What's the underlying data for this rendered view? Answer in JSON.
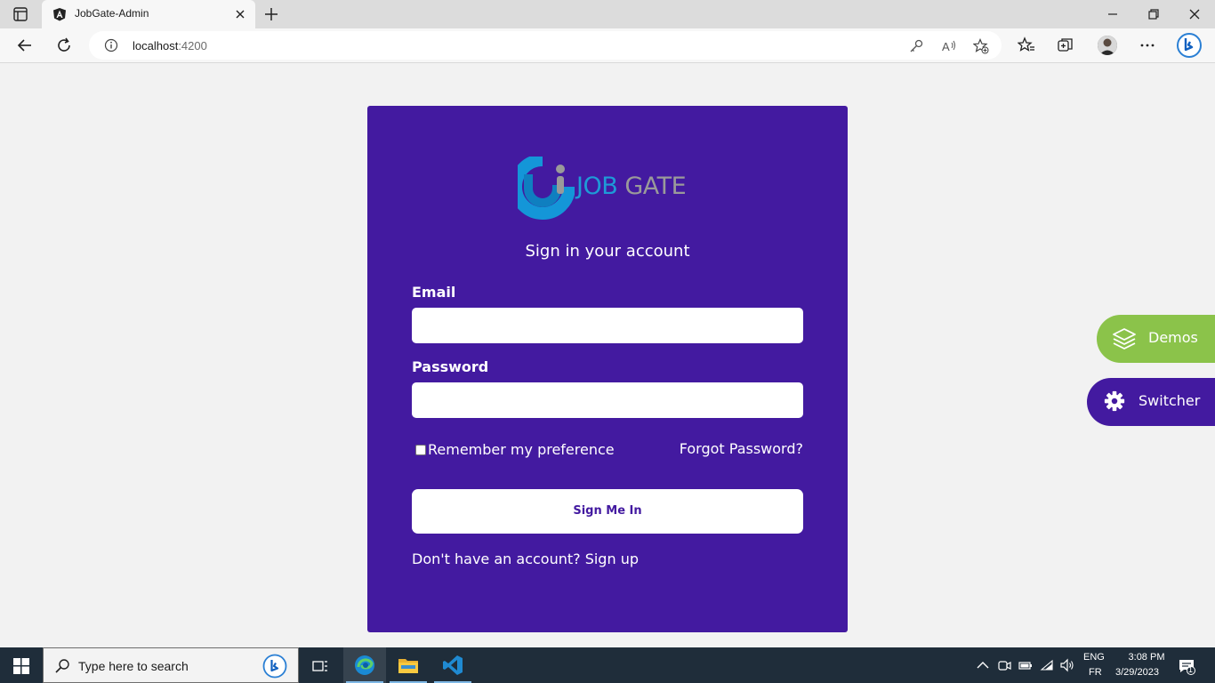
{
  "browser": {
    "tab_title": "JobGate-Admin",
    "url_host": "localhost",
    "url_port": ":4200"
  },
  "logo": {
    "word1": "JOB",
    "word2": "GATE"
  },
  "form": {
    "title": "Sign in your account",
    "email_label": "Email",
    "email_value": "",
    "password_label": "Password",
    "password_value": "",
    "remember_label": "Remember my preference",
    "remember_checked": false,
    "forgot_label": "Forgot Password?",
    "submit_label": "Sign Me In",
    "signup_text": "Don't have an account? Sign up"
  },
  "side_buttons": {
    "demos_label": "Demos",
    "switcher_label": "Switcher"
  },
  "taskbar": {
    "search_placeholder": "Type here to search",
    "lang_line1": "ENG",
    "lang_line2": "FR",
    "time": "3:08 PM",
    "date": "3/29/2023",
    "notification_count": "1"
  },
  "colors": {
    "card_bg": "#431aa0",
    "page_bg": "#f2f2f2",
    "demos_bg": "#8bc34a",
    "logo_blue": "#1e9bd7",
    "logo_gray": "#9a9a9a"
  },
  "icons": [
    "sidebar-icon",
    "angular-icon",
    "close-icon",
    "plus-icon",
    "minimize-icon",
    "restore-icon",
    "back-icon",
    "refresh-icon",
    "info-icon",
    "key-icon",
    "read-aloud-icon",
    "favorite-add-icon",
    "favorites-icon",
    "collections-icon",
    "more-icon",
    "bing-icon",
    "layers-icon",
    "gear-icon",
    "windows-icon",
    "search-icon",
    "task-view-icon",
    "edge-icon",
    "folder-icon",
    "vscode-icon",
    "chevron-up-icon",
    "meet-icon",
    "battery-icon",
    "wifi-icon",
    "volume-icon",
    "notification-icon"
  ]
}
